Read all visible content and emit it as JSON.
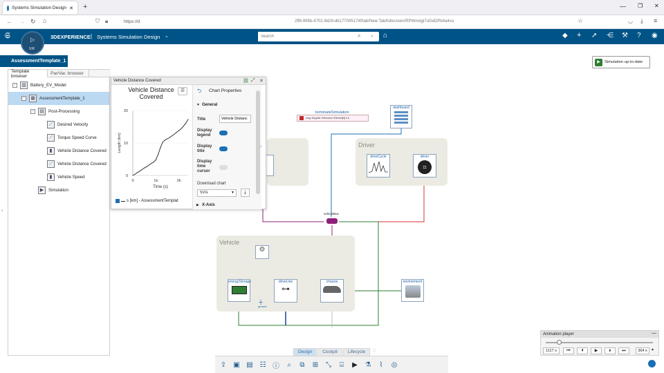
{
  "browser": {
    "tab_title": "Systems Simulation Design",
    "new_tab": "+",
    "url_prefix": "https://d",
    "url_rest": "2ff6-995b-4702-9d28-db177005174f/tab/New Tab/fullscreen/RPWmdgi7oGeDPb4a4va"
  },
  "app": {
    "brand": "3DEXPERIENCE",
    "app_name": "Systems Simulation Design",
    "compass_label": "V.R",
    "search_placeholder": "Search",
    "ribbon_title": "AssessmentTemplate_1",
    "simulation_status": "Simulation up-to-date"
  },
  "left_panel": {
    "tabs": [
      "Template browser",
      "Par/Var. browser"
    ],
    "tree": [
      {
        "label": "Battery_EV_Model",
        "indent": 0,
        "toggle": "-",
        "icon": "model-icon",
        "selected": false
      },
      {
        "label": "AssessmentTemplate_1",
        "indent": 1,
        "toggle": "-",
        "icon": "template-icon",
        "selected": true
      },
      {
        "label": "Post-Processing",
        "indent": 2,
        "toggle": "-",
        "icon": "folder-icon",
        "selected": false
      },
      {
        "label": "Desired Velocity",
        "indent": 3,
        "toggle": "",
        "icon": "line-chart-icon",
        "selected": false
      },
      {
        "label": "Torque Speed Curve",
        "indent": 3,
        "toggle": "",
        "icon": "line-chart-icon",
        "selected": false
      },
      {
        "label": "Vehicle Distance Covered",
        "indent": 3,
        "toggle": "",
        "icon": "bar-chart-icon",
        "selected": false
      },
      {
        "label": "Vehicle Distance Covered",
        "indent": 3,
        "toggle": "",
        "icon": "line-chart-icon",
        "selected": false
      },
      {
        "label": "Vehicle Speed",
        "indent": 3,
        "toggle": "",
        "icon": "bar-chart-icon",
        "selected": false
      },
      {
        "label": "Simulation",
        "indent": 2,
        "toggle": "",
        "icon": "simulation-icon",
        "selected": false
      }
    ]
  },
  "chart_panel": {
    "header": "Vehicle Distance Covered",
    "legend_text": "s [km] - AssessmentTemplat"
  },
  "chart_data": {
    "type": "line",
    "title": "Vehicle Distance Covered",
    "xlabel": "Time (s)",
    "ylabel": "Length (km)",
    "xlim": [
      0,
      2400
    ],
    "ylim": [
      0,
      20
    ],
    "x_ticks": [
      "0",
      "1k",
      "2k"
    ],
    "y_ticks": [
      "0",
      "10",
      "20"
    ],
    "series": [
      {
        "name": "s [km] - AssessmentTemplat",
        "x": [
          0,
          100,
          200,
          300,
          400,
          500,
          600,
          700,
          800,
          900,
          1000,
          1100,
          1200,
          1300,
          1400,
          1500,
          1600,
          1700,
          1800,
          1900,
          2000,
          2100,
          2200,
          2300,
          2400
        ],
        "y": [
          0,
          0.4,
          0.9,
          1.3,
          1.8,
          2.3,
          2.7,
          3.2,
          3.7,
          4.1,
          4.8,
          6.5,
          8.6,
          10.3,
          10.9,
          11.3,
          11.7,
          12.2,
          12.7,
          13.3,
          13.8,
          14.4,
          15.2,
          16.1,
          17.3
        ],
        "color": "#222222"
      }
    ]
  },
  "chart_properties": {
    "title": "Chart Properties",
    "section_general": "General",
    "title_label": "Title",
    "title_value": "Vehicle Distanc",
    "display_legend": "Display legend",
    "display_title": "Display title",
    "display_cursor": "Display time cursor",
    "download_label": "Download chart",
    "download_format": "SVG",
    "section_xaxis": "X-Axis"
  },
  "diagram": {
    "terminate_label": "terminateSimulation",
    "terminate_expr": "mng::Supplier::Resource::Element[0].0.&",
    "dashboard_label": "dashboard",
    "driver_group": "Driver",
    "vehicle_group": "Vehicle",
    "drivecycle_label": "driveCycle",
    "driver_label": "driver",
    "vehiclebus_label": "vehicleBus",
    "energystorage_label": "energyStorage",
    "driveline_label": "driveLine",
    "chassis_label": "chassis",
    "environment_label": "environment",
    "ground_label": "ground",
    "controller_label": "controller"
  },
  "mode_tabs": [
    "Design",
    "Cockpit",
    "Lifecycle"
  ],
  "animation_player": {
    "title": "Animation player",
    "time_value": "1117 s",
    "speed_value": "364 x",
    "progress": 0.12
  },
  "colors": {
    "brand_blue": "#005386",
    "accent_blue": "#1a6fb5",
    "vehicle_bus": "#8e1f7a",
    "green_line": "#2e7d32"
  }
}
